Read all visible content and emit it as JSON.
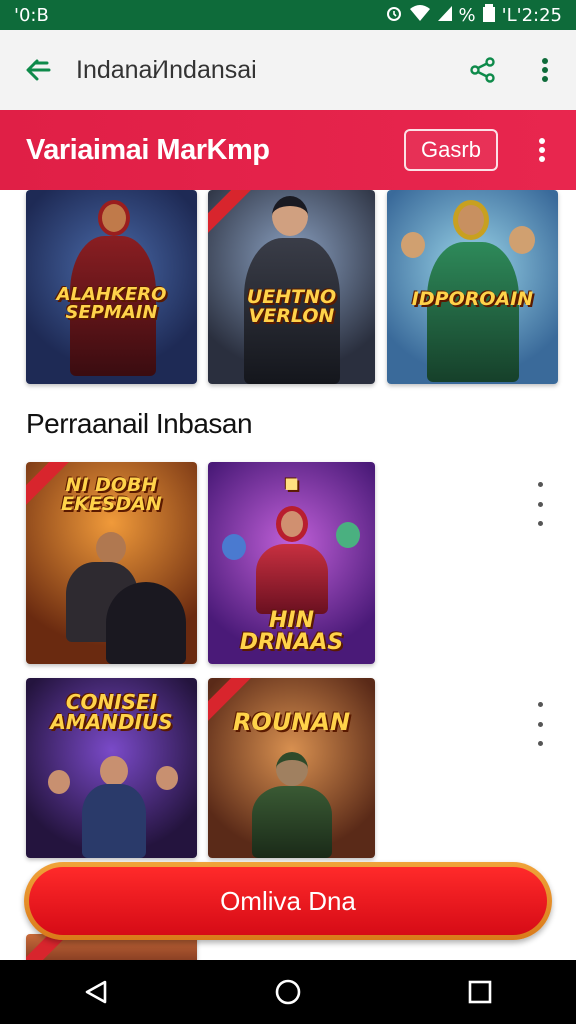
{
  "status_bar": {
    "time_left": "'0:B",
    "battery_text": "%",
    "time_right": "'L'2:25"
  },
  "toolbar": {
    "title": "Indanai⁄Indansai",
    "back_icon": "back-arrow-icon",
    "share_icon": "share-icon",
    "more_icon": "more-vert-icon"
  },
  "header": {
    "title": "Variaimai MarKmp",
    "search_label": "Gasrb",
    "bg_color": "#e01f46"
  },
  "section": {
    "title": "Perraanail Inbasan"
  },
  "top_row": [
    {
      "caption": "ALAHKERO SEPMAIN",
      "theme": "red"
    },
    {
      "caption": "UEHTNO VERLON",
      "theme": "dark"
    },
    {
      "caption": "IDPOROAIN",
      "theme": "blue"
    }
  ],
  "grid_rows": [
    {
      "cards": [
        {
          "caption": "NI DOBH EKESDAN",
          "theme": "orange"
        },
        {
          "caption": "HIN DRNAAS",
          "theme": "purple"
        }
      ]
    },
    {
      "cards": [
        {
          "caption": "CONISEI AMANDIUS",
          "theme": "violet"
        },
        {
          "caption": "ROUNAN",
          "theme": "brown"
        }
      ]
    }
  ],
  "cta": {
    "label": "Omliva Dna"
  },
  "navbar": {
    "back_icon": "nav-back-icon",
    "home_icon": "nav-home-icon",
    "recents_icon": "nav-recents-icon"
  }
}
